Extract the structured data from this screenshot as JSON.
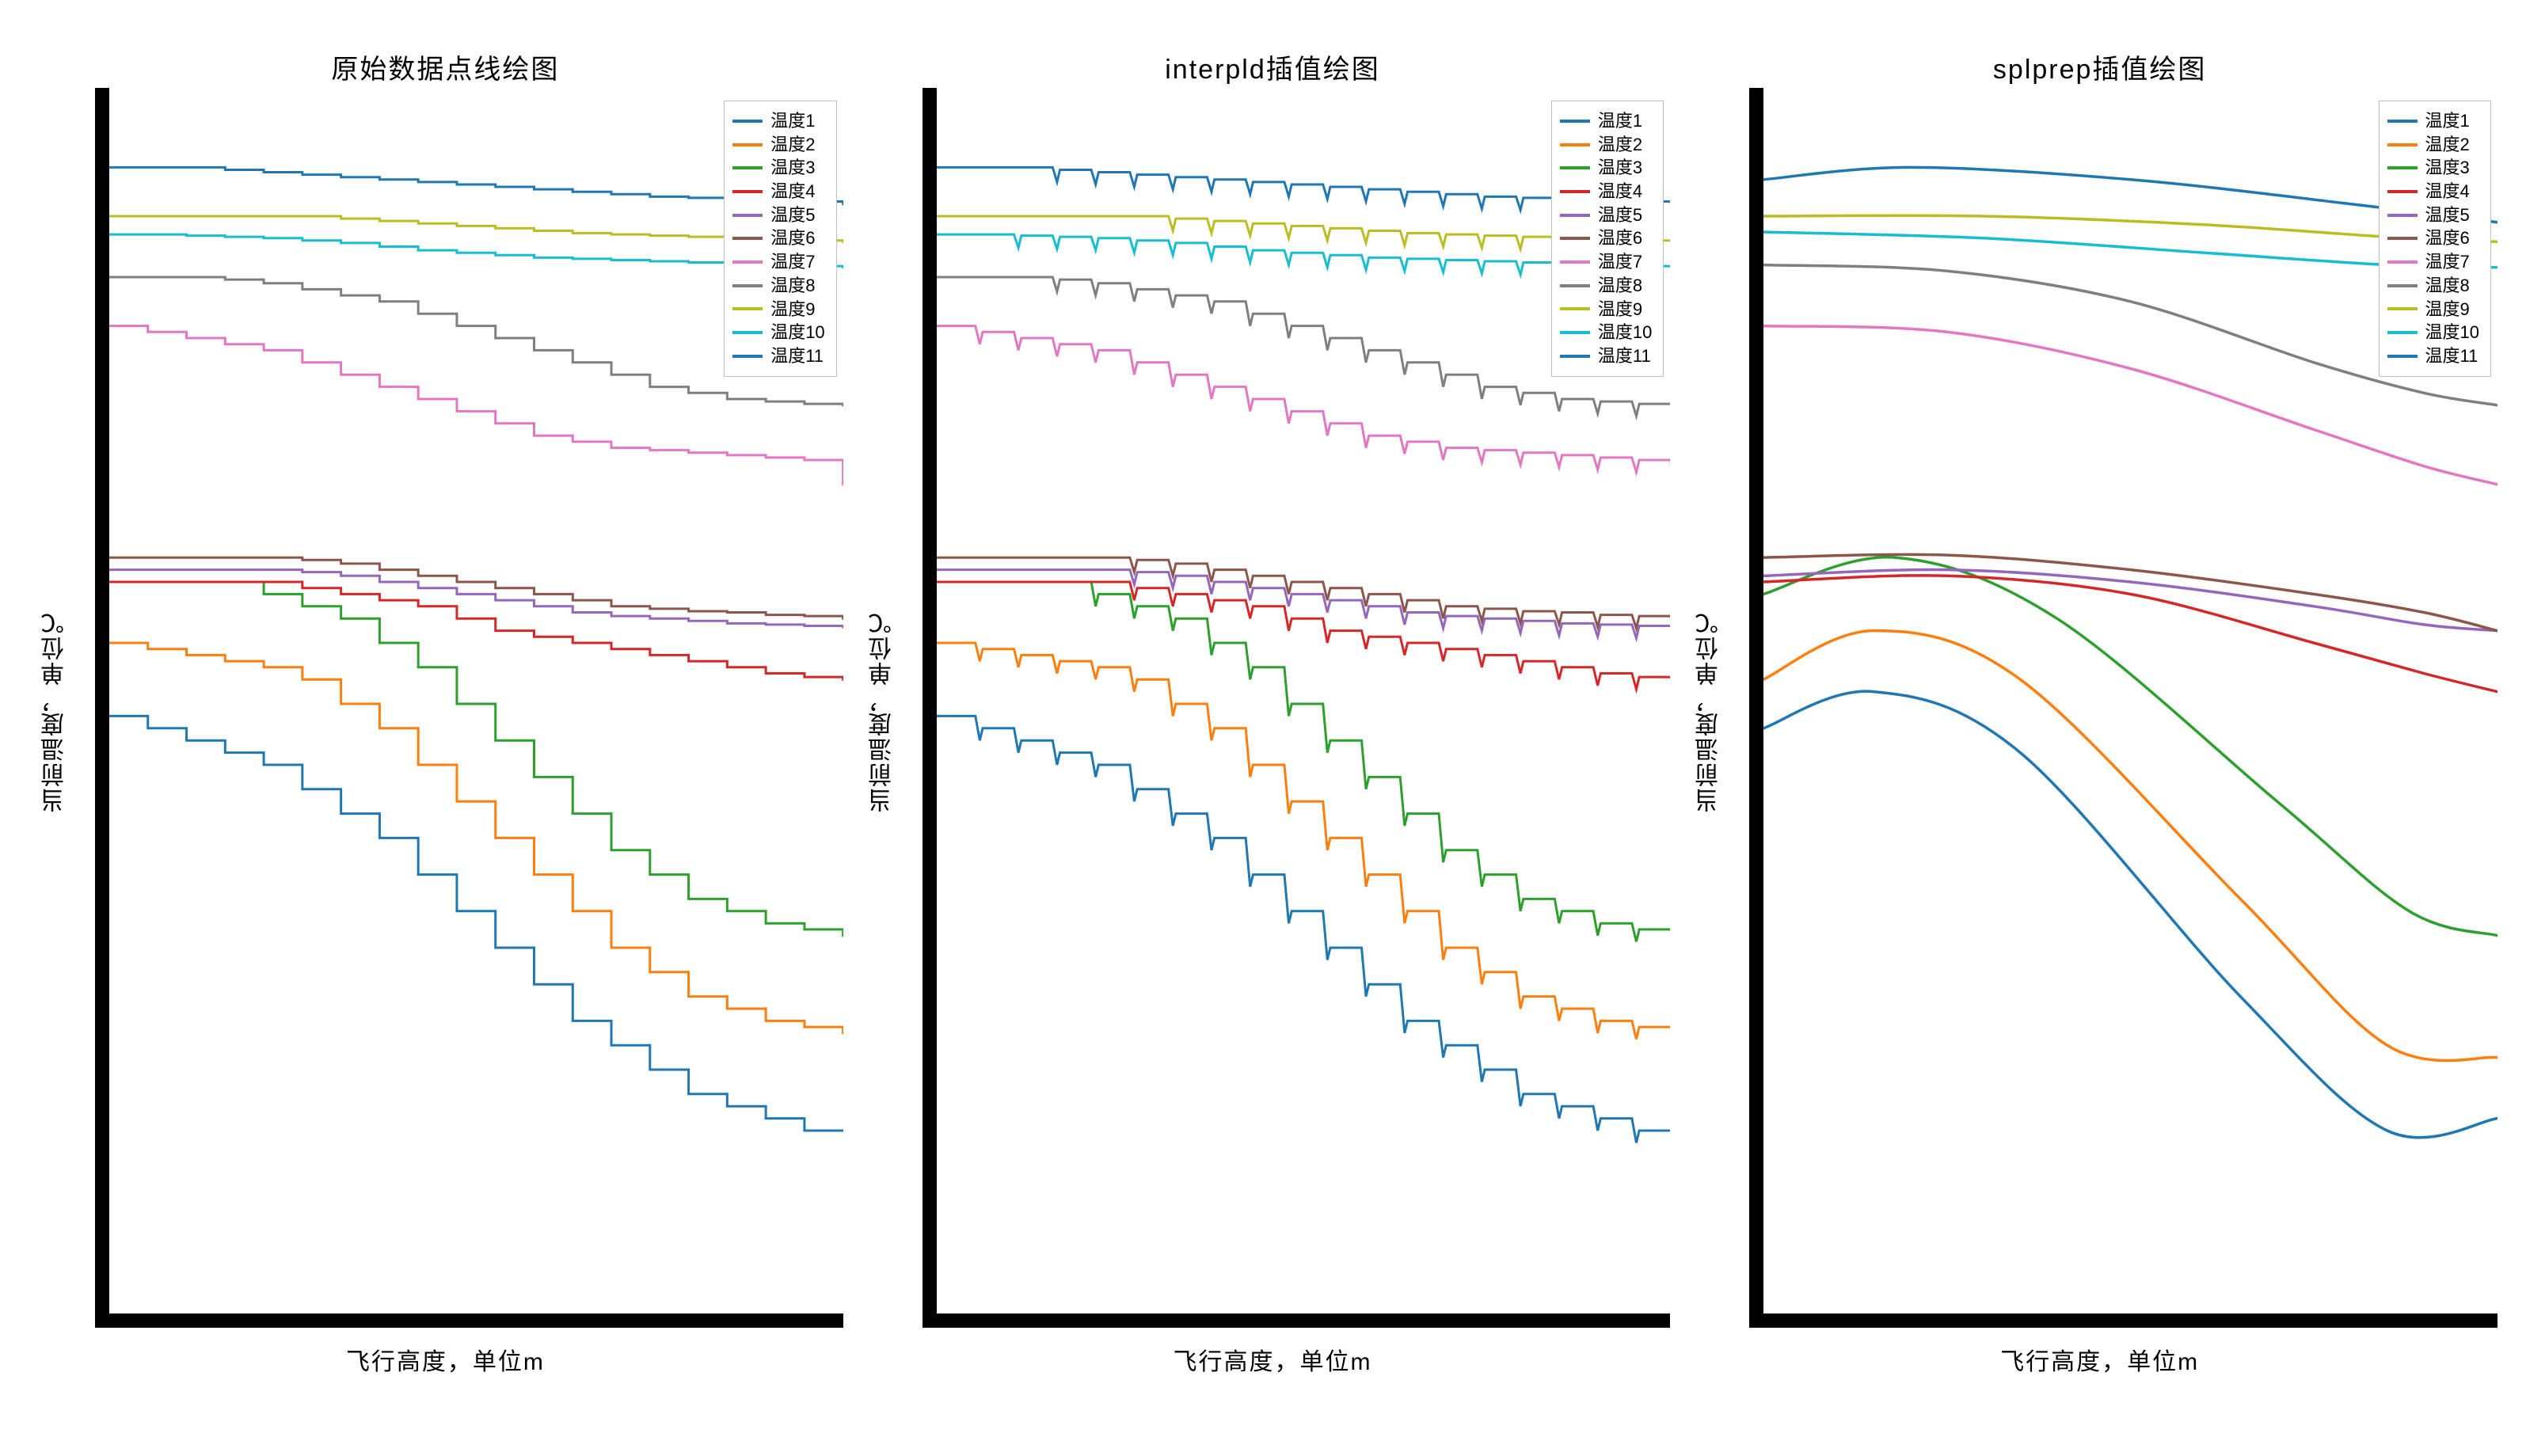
{
  "chart_data": [
    {
      "type": "line",
      "id": "panel-raw",
      "title": "原始数据点线绘图",
      "xlabel": "飞行高度，单位m",
      "ylabel": "当前温度，单位℃",
      "xlim": [
        0,
        100
      ],
      "ylim": [
        0,
        100
      ],
      "render": "step",
      "series": [
        {
          "name": "温度1",
          "color": "#1f77b4",
          "values": [
            49,
            48,
            47,
            46,
            45,
            43,
            41,
            39,
            36,
            33,
            30,
            27,
            24,
            22,
            20,
            18,
            17,
            16,
            15,
            15
          ]
        },
        {
          "name": "温度2",
          "color": "#ff7f0e",
          "values": [
            55,
            54.5,
            54,
            53.5,
            53,
            52,
            50,
            48,
            45,
            42,
            39,
            36,
            33,
            30,
            28,
            26,
            25,
            24,
            23.5,
            23
          ]
        },
        {
          "name": "温度3",
          "color": "#2ca02c",
          "values": [
            60,
            60,
            60,
            60,
            59,
            58,
            57,
            55,
            53,
            50,
            47,
            44,
            41,
            38,
            36,
            34,
            33,
            32,
            31.5,
            31
          ]
        },
        {
          "name": "温度4",
          "color": "#d62728",
          "values": [
            60,
            60,
            60,
            60,
            60,
            59.5,
            59,
            58.5,
            58,
            57,
            56,
            55.5,
            55,
            54.5,
            54,
            53.5,
            53,
            52.5,
            52.2,
            52
          ]
        },
        {
          "name": "温度5",
          "color": "#9467bd",
          "values": [
            61,
            61,
            61,
            61,
            61,
            60.8,
            60.5,
            60,
            59.5,
            59,
            58.5,
            58,
            57.5,
            57.2,
            57,
            56.8,
            56.6,
            56.5,
            56.4,
            56.3
          ]
        },
        {
          "name": "温度6",
          "color": "#8c564b",
          "values": [
            62,
            62,
            62,
            62,
            62,
            61.8,
            61.5,
            61,
            60.5,
            60,
            59.5,
            59,
            58.5,
            58,
            57.8,
            57.6,
            57.5,
            57.3,
            57.2,
            57
          ]
        },
        {
          "name": "温度7",
          "color": "#e377c2",
          "values": [
            81,
            80.5,
            80,
            79.5,
            79,
            78,
            77,
            76,
            75,
            74,
            73,
            72,
            71.5,
            71,
            70.8,
            70.6,
            70.4,
            70.2,
            70,
            68
          ]
        },
        {
          "name": "温度8",
          "color": "#7f7f7f",
          "values": [
            85,
            85,
            85,
            84.8,
            84.5,
            84,
            83.5,
            83,
            82,
            81,
            80,
            79,
            78,
            77,
            76,
            75.5,
            75,
            74.8,
            74.6,
            74.5
          ]
        },
        {
          "name": "温度9",
          "color": "#bcbd22",
          "values": [
            90,
            90,
            90,
            90,
            90,
            90,
            89.8,
            89.6,
            89.4,
            89.2,
            89,
            88.8,
            88.6,
            88.5,
            88.4,
            88.3,
            88.2,
            88.1,
            88,
            87.9
          ]
        },
        {
          "name": "温度10",
          "color": "#17becf",
          "values": [
            88.5,
            88.5,
            88.4,
            88.3,
            88.2,
            88,
            87.8,
            87.5,
            87.2,
            87,
            86.8,
            86.6,
            86.5,
            86.4,
            86.3,
            86.2,
            86.1,
            86,
            85.9,
            85.8
          ]
        },
        {
          "name": "温度11",
          "color": "#1f77b4",
          "values": [
            94,
            94,
            94,
            93.8,
            93.6,
            93.4,
            93.2,
            93,
            92.8,
            92.6,
            92.4,
            92.2,
            92,
            91.8,
            91.6,
            91.5,
            91.4,
            91.3,
            91.2,
            91
          ]
        }
      ]
    },
    {
      "type": "line",
      "id": "panel-interpld",
      "title": "interpld插值绘图",
      "xlabel": "飞行高度，单位m",
      "ylabel": "当前温度，单位℃",
      "xlim": [
        0,
        100
      ],
      "ylim": [
        0,
        100
      ],
      "render": "step-jitter",
      "series": [
        {
          "name": "温度1",
          "color": "#1f77b4",
          "values": [
            49,
            48,
            47,
            46,
            45,
            43,
            41,
            39,
            36,
            33,
            30,
            27,
            24,
            22,
            20,
            18,
            17,
            16,
            15,
            15
          ]
        },
        {
          "name": "温度2",
          "color": "#ff7f0e",
          "values": [
            55,
            54.5,
            54,
            53.5,
            53,
            52,
            50,
            48,
            45,
            42,
            39,
            36,
            33,
            30,
            28,
            26,
            25,
            24,
            23.5,
            23
          ]
        },
        {
          "name": "温度3",
          "color": "#2ca02c",
          "values": [
            60,
            60,
            60,
            60,
            59,
            58,
            57,
            55,
            53,
            50,
            47,
            44,
            41,
            38,
            36,
            34,
            33,
            32,
            31.5,
            31
          ]
        },
        {
          "name": "温度4",
          "color": "#d62728",
          "values": [
            60,
            60,
            60,
            60,
            60,
            59.5,
            59,
            58.5,
            58,
            57,
            56,
            55.5,
            55,
            54.5,
            54,
            53.5,
            53,
            52.5,
            52.2,
            52
          ]
        },
        {
          "name": "温度5",
          "color": "#9467bd",
          "values": [
            61,
            61,
            61,
            61,
            61,
            60.8,
            60.5,
            60,
            59.5,
            59,
            58.5,
            58,
            57.5,
            57.2,
            57,
            56.8,
            56.6,
            56.5,
            56.4,
            56.3
          ]
        },
        {
          "name": "温度6",
          "color": "#8c564b",
          "values": [
            62,
            62,
            62,
            62,
            62,
            61.8,
            61.5,
            61,
            60.5,
            60,
            59.5,
            59,
            58.5,
            58,
            57.8,
            57.6,
            57.5,
            57.3,
            57.2,
            57
          ]
        },
        {
          "name": "温度7",
          "color": "#e377c2",
          "values": [
            81,
            80.5,
            80,
            79.5,
            79,
            78,
            77,
            76,
            75,
            74,
            73,
            72,
            71.5,
            71,
            70.8,
            70.6,
            70.4,
            70.2,
            70,
            68
          ]
        },
        {
          "name": "温度8",
          "color": "#7f7f7f",
          "values": [
            85,
            85,
            85,
            84.8,
            84.5,
            84,
            83.5,
            83,
            82,
            81,
            80,
            79,
            78,
            77,
            76,
            75.5,
            75,
            74.8,
            74.6,
            74.5
          ]
        },
        {
          "name": "温度9",
          "color": "#bcbd22",
          "values": [
            90,
            90,
            90,
            90,
            90,
            90,
            89.8,
            89.6,
            89.4,
            89.2,
            89,
            88.8,
            88.6,
            88.5,
            88.4,
            88.3,
            88.2,
            88.1,
            88,
            87.9
          ]
        },
        {
          "name": "温度10",
          "color": "#17becf",
          "values": [
            88.5,
            88.5,
            88.4,
            88.3,
            88.2,
            88,
            87.8,
            87.5,
            87.2,
            87,
            86.8,
            86.6,
            86.5,
            86.4,
            86.3,
            86.2,
            86.1,
            86,
            85.9,
            85.8
          ]
        },
        {
          "name": "温度11",
          "color": "#1f77b4",
          "values": [
            94,
            94,
            94,
            93.8,
            93.6,
            93.4,
            93.2,
            93,
            92.8,
            92.6,
            92.4,
            92.2,
            92,
            91.8,
            91.6,
            91.5,
            91.4,
            91.3,
            91.2,
            91
          ]
        }
      ]
    },
    {
      "type": "line",
      "id": "panel-splprep",
      "title": "splprep插值绘图",
      "xlabel": "飞行高度，单位m",
      "ylabel": "当前温度，单位℃",
      "xlim": [
        0,
        100
      ],
      "ylim": [
        0,
        100
      ],
      "render": "smooth",
      "series": [
        {
          "name": "温度1",
          "color": "#1f77b4",
          "control": [
            [
              0,
              48
            ],
            [
              15,
              51
            ],
            [
              35,
              46
            ],
            [
              65,
              26
            ],
            [
              85,
              15
            ],
            [
              100,
              16
            ]
          ]
        },
        {
          "name": "温度2",
          "color": "#ff7f0e",
          "control": [
            [
              0,
              52
            ],
            [
              15,
              56
            ],
            [
              35,
              52
            ],
            [
              65,
              34
            ],
            [
              85,
              22
            ],
            [
              100,
              21
            ]
          ]
        },
        {
          "name": "温度3",
          "color": "#2ca02c",
          "control": [
            [
              0,
              59
            ],
            [
              18,
              62
            ],
            [
              40,
              57
            ],
            [
              70,
              42
            ],
            [
              88,
              33
            ],
            [
              100,
              31
            ]
          ]
        },
        {
          "name": "温度4",
          "color": "#d62728",
          "control": [
            [
              0,
              60
            ],
            [
              25,
              60.5
            ],
            [
              50,
              59
            ],
            [
              75,
              55
            ],
            [
              90,
              52.5
            ],
            [
              100,
              51
            ]
          ]
        },
        {
          "name": "温度5",
          "color": "#9467bd",
          "control": [
            [
              0,
              60.5
            ],
            [
              25,
              61
            ],
            [
              50,
              60
            ],
            [
              75,
              58
            ],
            [
              90,
              56.5
            ],
            [
              100,
              56
            ]
          ]
        },
        {
          "name": "温度6",
          "color": "#8c564b",
          "control": [
            [
              0,
              62
            ],
            [
              25,
              62.2
            ],
            [
              50,
              61
            ],
            [
              75,
              59
            ],
            [
              90,
              57.5
            ],
            [
              100,
              56
            ]
          ]
        },
        {
          "name": "温度7",
          "color": "#e377c2",
          "control": [
            [
              0,
              81
            ],
            [
              25,
              80.5
            ],
            [
              50,
              77.5
            ],
            [
              75,
              72.5
            ],
            [
              90,
              69.5
            ],
            [
              100,
              68
            ]
          ]
        },
        {
          "name": "温度8",
          "color": "#7f7f7f",
          "control": [
            [
              0,
              86
            ],
            [
              25,
              85.5
            ],
            [
              50,
              83
            ],
            [
              75,
              78
            ],
            [
              90,
              75.5
            ],
            [
              100,
              74.5
            ]
          ]
        },
        {
          "name": "温度9",
          "color": "#bcbd22",
          "control": [
            [
              0,
              90
            ],
            [
              30,
              90
            ],
            [
              60,
              89.3
            ],
            [
              85,
              88.3
            ],
            [
              100,
              87.9
            ]
          ]
        },
        {
          "name": "温度10",
          "color": "#17becf",
          "control": [
            [
              0,
              88.7
            ],
            [
              30,
              88.2
            ],
            [
              60,
              87
            ],
            [
              85,
              86
            ],
            [
              100,
              85.8
            ]
          ]
        },
        {
          "name": "温度11",
          "color": "#1f77b4",
          "control": [
            [
              0,
              93
            ],
            [
              20,
              94
            ],
            [
              50,
              93
            ],
            [
              80,
              91
            ],
            [
              100,
              89.5
            ]
          ]
        }
      ]
    }
  ]
}
